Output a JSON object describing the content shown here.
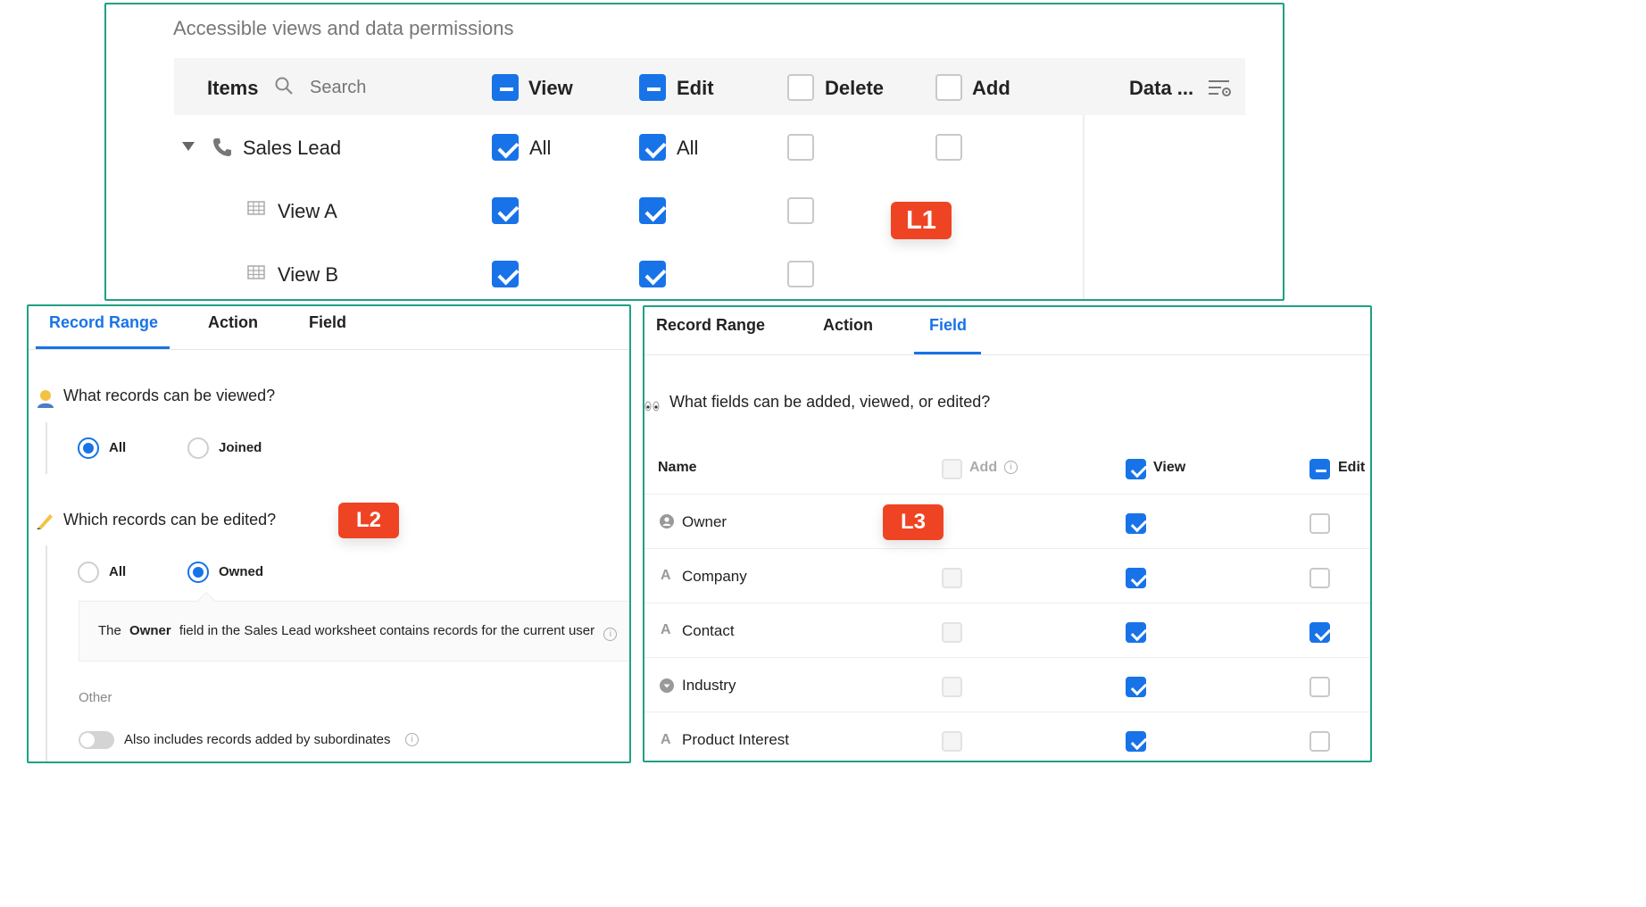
{
  "l1": {
    "title": "Accessible views and data permissions",
    "header": {
      "items_label": "Items",
      "search_placeholder": "Search",
      "view_label": "View",
      "edit_label": "Edit",
      "delete_label": "Delete",
      "add_label": "Add",
      "data_label": "Data ..."
    },
    "rows": [
      {
        "label": "Sales Lead",
        "view_text": "All",
        "edit_text": "All"
      },
      {
        "label": "View A"
      },
      {
        "label": "View B"
      }
    ],
    "badge": "L1"
  },
  "l2": {
    "tabs": [
      "Record Range",
      "Action",
      "Field"
    ],
    "q1": "What records can be viewed?",
    "q1_options": [
      "All",
      "Joined"
    ],
    "q2": "Which records can be edited?",
    "q2_options": [
      "All",
      "Owned"
    ],
    "note": {
      "pre": "The",
      "field": "Owner",
      "post": "field in the Sales Lead worksheet contains records for the current user"
    },
    "other_label": "Other",
    "toggle_label": "Also includes records added by subordinates",
    "badge": "L2"
  },
  "l3": {
    "tabs": [
      "Record Range",
      "Action",
      "Field"
    ],
    "question": "What fields can be added, viewed, or edited?",
    "columns": {
      "name": "Name",
      "add": "Add",
      "view": "View",
      "edit": "Edit"
    },
    "fields": [
      {
        "name": "Owner",
        "icon": "user-circle-icon",
        "add": null,
        "view": true,
        "edit": false
      },
      {
        "name": "Company",
        "icon": "text-type-icon",
        "add": false,
        "view": true,
        "edit": false
      },
      {
        "name": "Contact",
        "icon": "text-type-icon",
        "add": false,
        "view": true,
        "edit": true
      },
      {
        "name": "Industry",
        "icon": "dropdown-type-icon",
        "add": false,
        "view": true,
        "edit": false
      },
      {
        "name": "Product Interest",
        "icon": "text-type-icon",
        "add": false,
        "view": true,
        "edit": false
      }
    ],
    "badge": "L3"
  },
  "colors": {
    "accent": "#1873e8",
    "frame": "#1fa083",
    "badge": "#ef4423"
  }
}
